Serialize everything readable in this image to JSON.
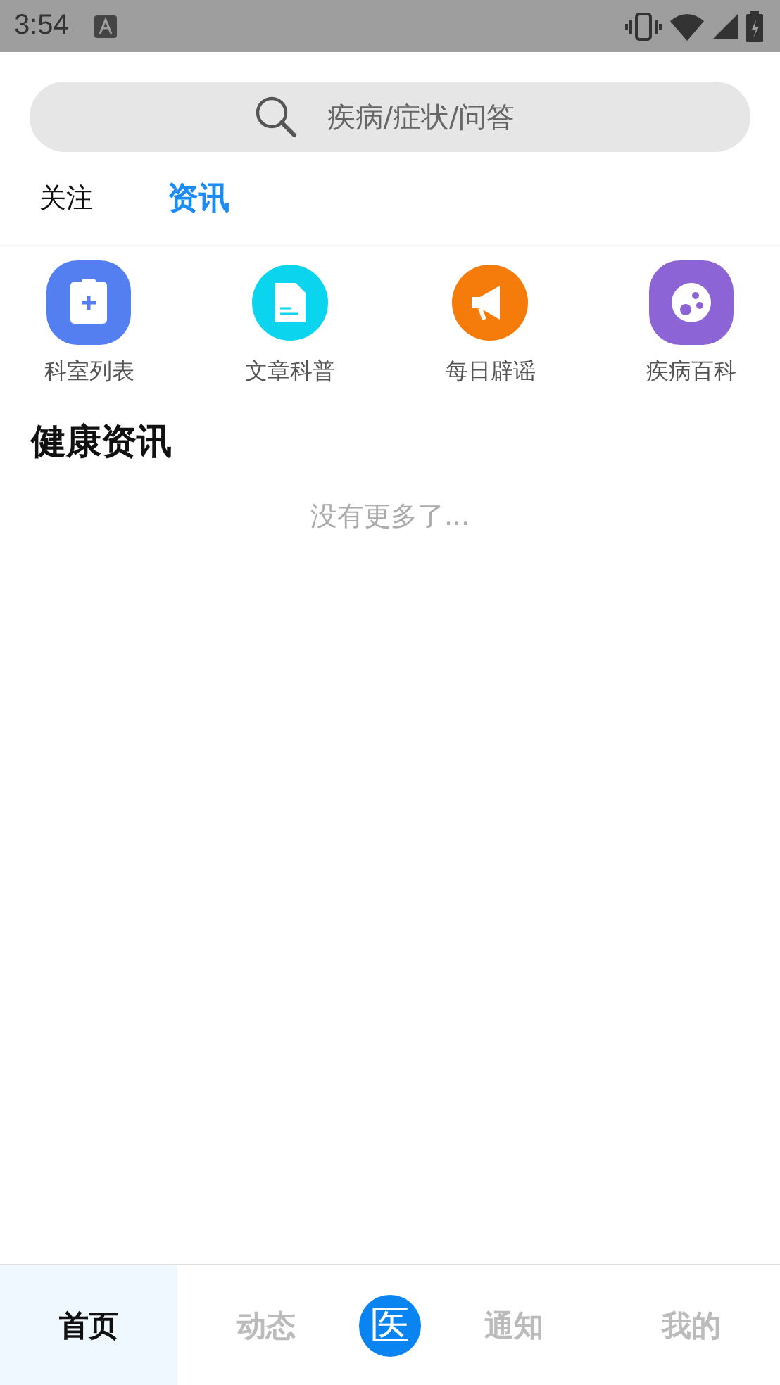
{
  "status_bar": {
    "time": "3:54"
  },
  "search": {
    "placeholder": "疾病/症状/问答"
  },
  "tabs": [
    {
      "label": "关注",
      "selected": false
    },
    {
      "label": "资讯",
      "selected": true
    }
  ],
  "shortcuts": [
    {
      "label": "科室列表",
      "kind": "clipboard",
      "color": "#547ff0"
    },
    {
      "label": "文章科普",
      "kind": "document",
      "color": "#0ad4ee"
    },
    {
      "label": "每日辟谣",
      "kind": "megaphone",
      "color": "#f57c0a"
    },
    {
      "label": "疾病百科",
      "kind": "germ",
      "color": "#8c64d6"
    }
  ],
  "section": {
    "title": "健康资讯",
    "empty_text": "没有更多了..."
  },
  "bottom_nav": [
    {
      "label": "首页",
      "kind": "tab",
      "selected": true
    },
    {
      "label": "动态",
      "kind": "tab",
      "selected": false
    },
    {
      "label": "医",
      "kind": "logo"
    },
    {
      "label": "通知",
      "kind": "tab",
      "selected": false
    },
    {
      "label": "我的",
      "kind": "tab",
      "selected": false
    }
  ]
}
